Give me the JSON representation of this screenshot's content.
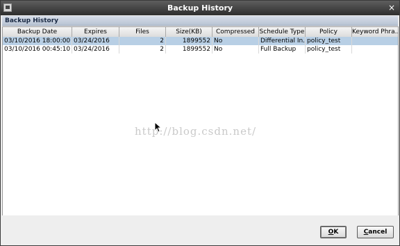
{
  "window": {
    "title": "Backup History",
    "close_glyph": "×"
  },
  "panel": {
    "header": "Backup History"
  },
  "table": {
    "columns": [
      "Backup Date",
      "Expires",
      "Files",
      "Size(KB)",
      "Compressed",
      "Schedule Type",
      "Policy",
      "Keyword Phra..."
    ],
    "rows": [
      {
        "backup_date": "03/10/2016 18:00:00",
        "expires": "03/24/2016",
        "files": "2",
        "size_kb": "1899552",
        "compressed": "No",
        "schedule_type": "Differential In...",
        "policy": "policy_test",
        "keyword": "",
        "selected": true
      },
      {
        "backup_date": "03/10/2016 00:45:10",
        "expires": "03/24/2016",
        "files": "2",
        "size_kb": "1899552",
        "compressed": "No",
        "schedule_type": "Full Backup",
        "policy": "policy_test",
        "keyword": "",
        "selected": false
      }
    ]
  },
  "watermark": "http://blog.csdn.net/",
  "buttons": {
    "ok": {
      "mnemonic": "O",
      "rest": "K"
    },
    "cancel": {
      "mnemonic": "C",
      "rest": "ancel"
    }
  },
  "colors": {
    "titlebar": "#3c3c3c",
    "selection": "#b8cfe5",
    "panel_header": "#c8d1df"
  }
}
